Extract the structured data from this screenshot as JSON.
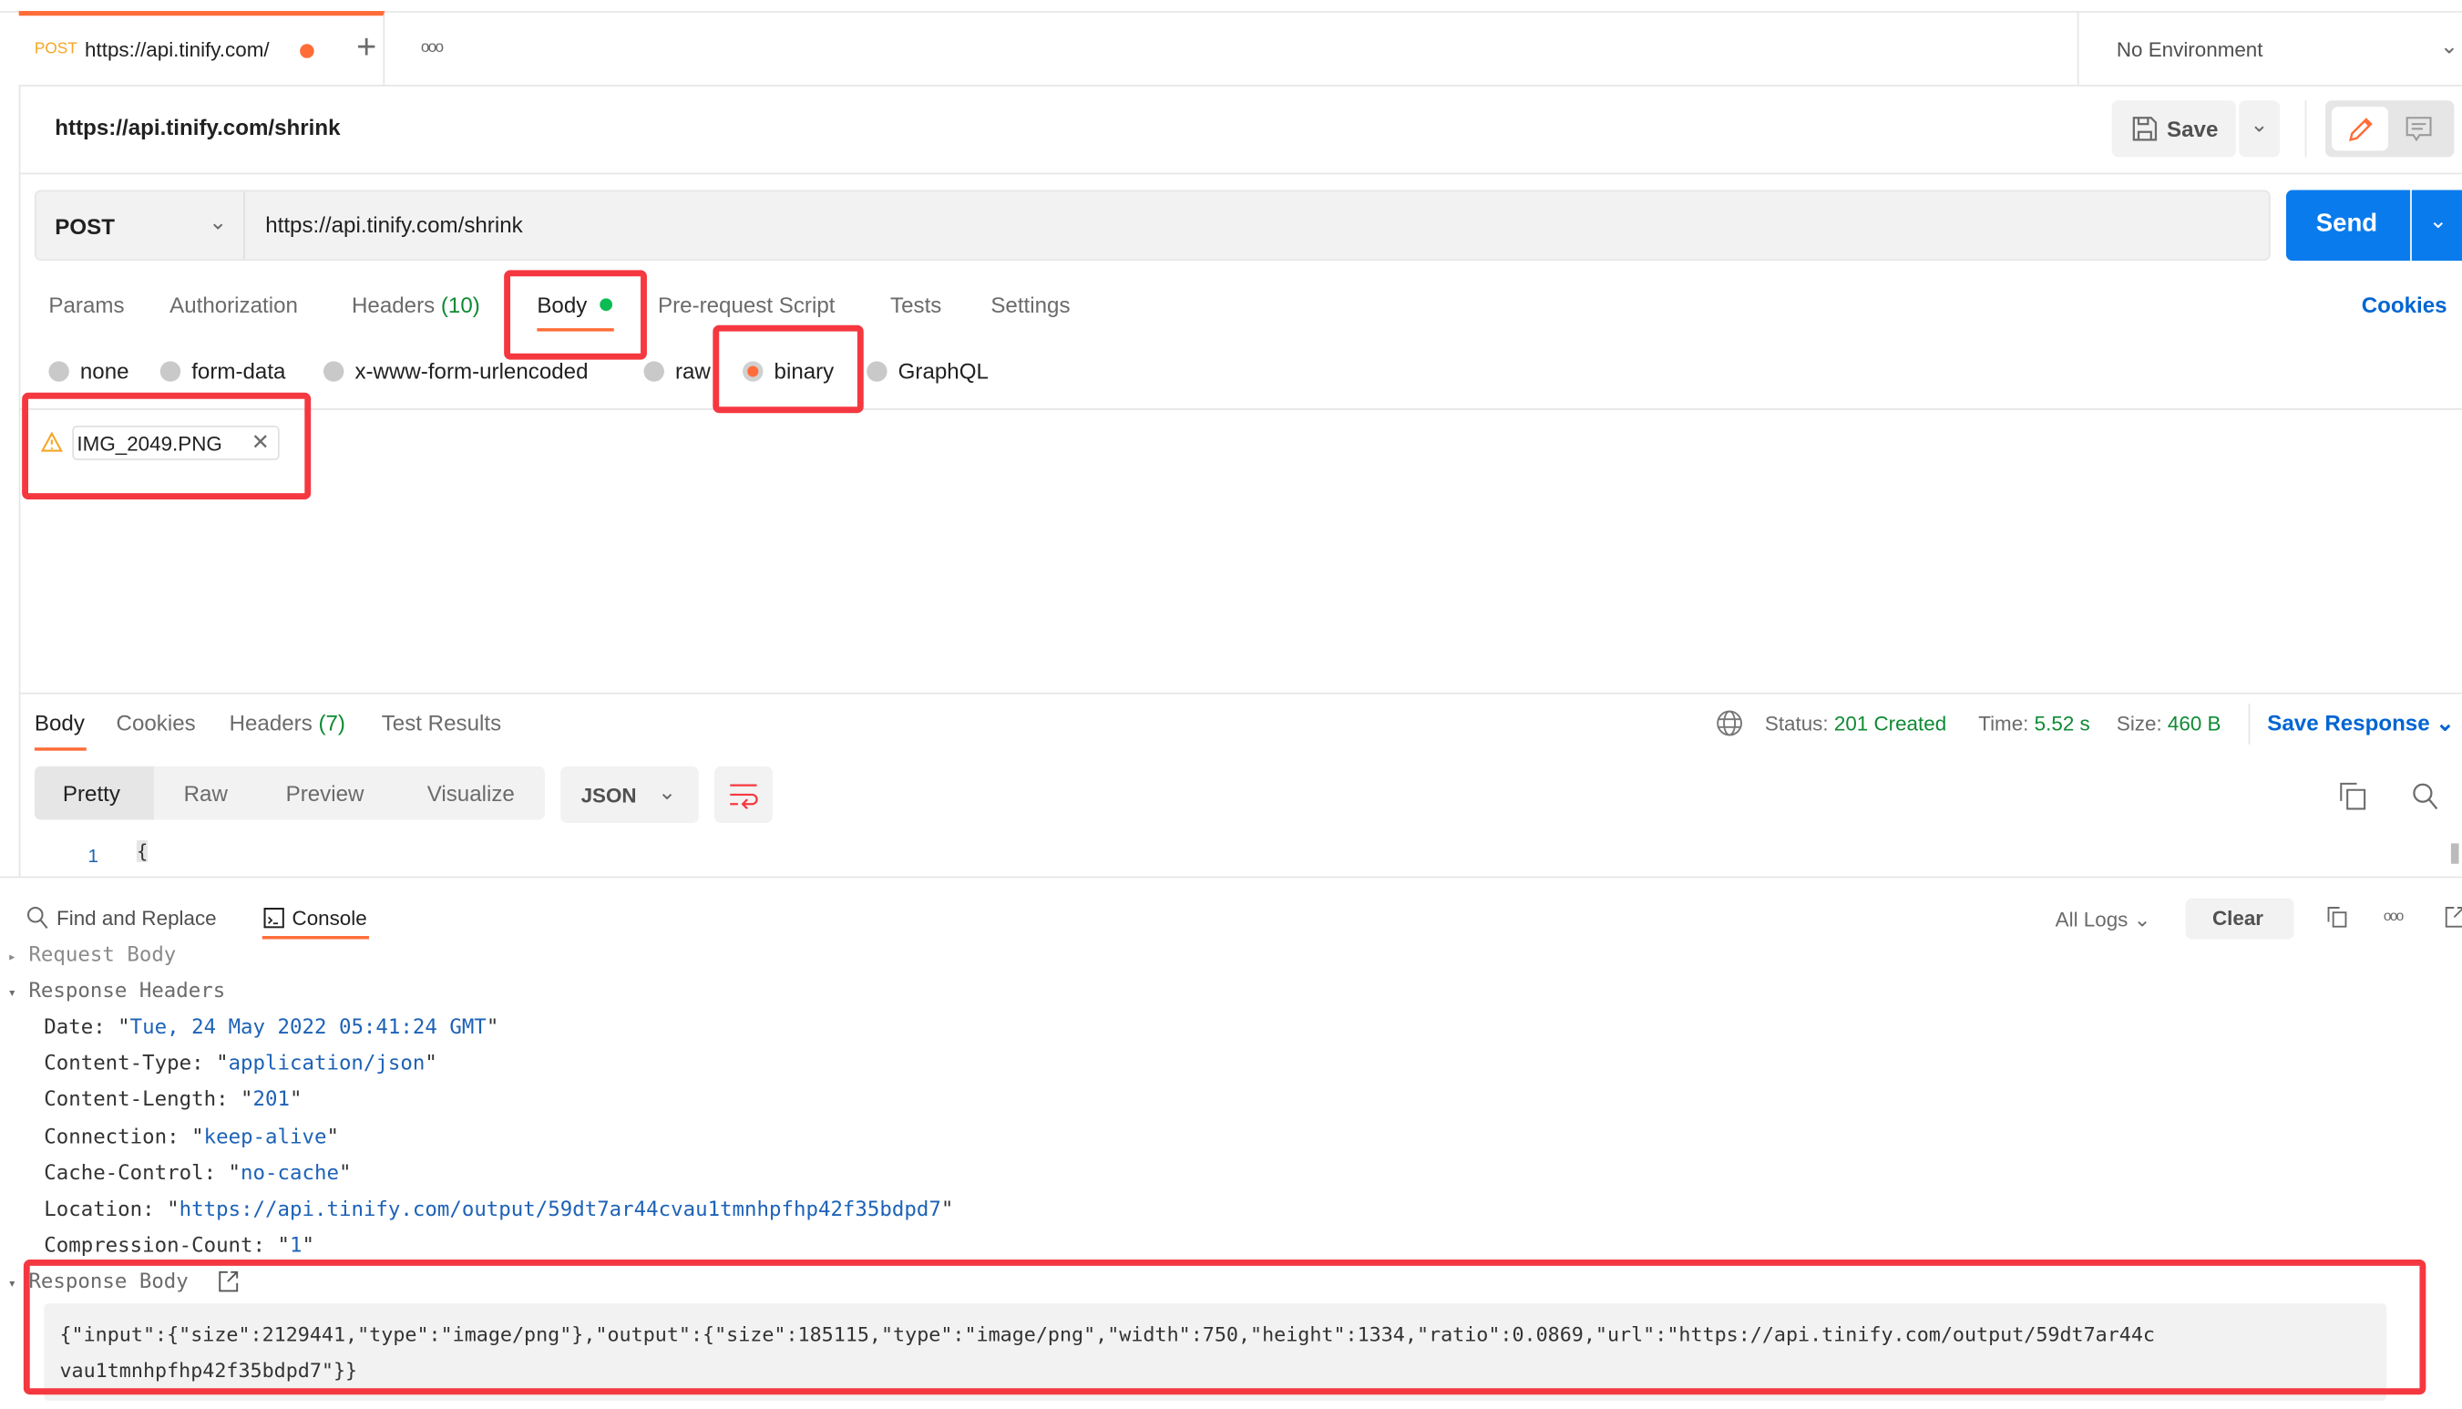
{
  "tab": {
    "method": "POST",
    "url": "https://api.tinify.com/",
    "unsaved": true
  },
  "tab_actions": {
    "new_tab": "+",
    "more": "ooo"
  },
  "environment": {
    "selected": "No Environment"
  },
  "request": {
    "title": "https://api.tinify.com/shrink",
    "save_label": "Save",
    "method": "POST",
    "url": "https://api.tinify.com/shrink",
    "send_label": "Send",
    "cookies_label": "Cookies",
    "tabs": [
      {
        "label": "Params"
      },
      {
        "label": "Authorization"
      },
      {
        "label": "Headers",
        "count": "(10)"
      },
      {
        "label": "Body",
        "active": true
      },
      {
        "label": "Pre-request Script"
      },
      {
        "label": "Tests"
      },
      {
        "label": "Settings"
      }
    ],
    "body_modes": [
      {
        "label": "none"
      },
      {
        "label": "form-data"
      },
      {
        "label": "x-www-form-urlencoded"
      },
      {
        "label": "raw"
      },
      {
        "label": "binary",
        "selected": true
      },
      {
        "label": "GraphQL"
      }
    ],
    "file": "IMG_2049.PNG"
  },
  "response": {
    "tabs": [
      {
        "label": "Body",
        "active": true
      },
      {
        "label": "Cookies"
      },
      {
        "label": "Headers",
        "count": "(7)"
      },
      {
        "label": "Test Results"
      }
    ],
    "status_label": "Status:",
    "status": "201 Created",
    "time_label": "Time:",
    "time": "5.52 s",
    "size_label": "Size:",
    "size": "460 B",
    "save_response": "Save Response",
    "views": [
      "Pretty",
      "Raw",
      "Preview",
      "Visualize"
    ],
    "format": "JSON",
    "line_number": "1",
    "line_content": "{"
  },
  "console": {
    "find_replace": "Find and Replace",
    "console_label": "Console",
    "filter": "All Logs",
    "clear": "Clear",
    "request_body": "Request Body",
    "response_headers_label": "Response Headers",
    "headers": [
      {
        "key": "Date",
        "value": "Tue, 24 May 2022 05:41:24 GMT"
      },
      {
        "key": "Content-Type",
        "value": "application/json"
      },
      {
        "key": "Content-Length",
        "value": "201"
      },
      {
        "key": "Connection",
        "value": "keep-alive"
      },
      {
        "key": "Cache-Control",
        "value": "no-cache"
      },
      {
        "key": "Location",
        "value": "https://api.tinify.com/output/59dt7ar44cvau1tmnhpfhp42f35bdpd7"
      },
      {
        "key": "Compression-Count",
        "value": "1"
      }
    ],
    "response_body_label": "Response Body",
    "response_body_line1": "{\"input\":{\"size\":2129441,\"type\":\"image/png\"},\"output\":{\"size\":185115,\"type\":\"image/png\",\"width\":750,\"height\":1334,\"ratio\":0.0869,\"url\":\"https://api.tinify.com/output/59dt7ar44c",
    "response_body_line2": "vau1tmnhpfhp42f35bdpd7\"}}"
  },
  "colors": {
    "accent": "#ff6c37",
    "send": "#097bed",
    "success": "#0f8a34",
    "link": "#0265d2",
    "highlight": "#f53840"
  }
}
